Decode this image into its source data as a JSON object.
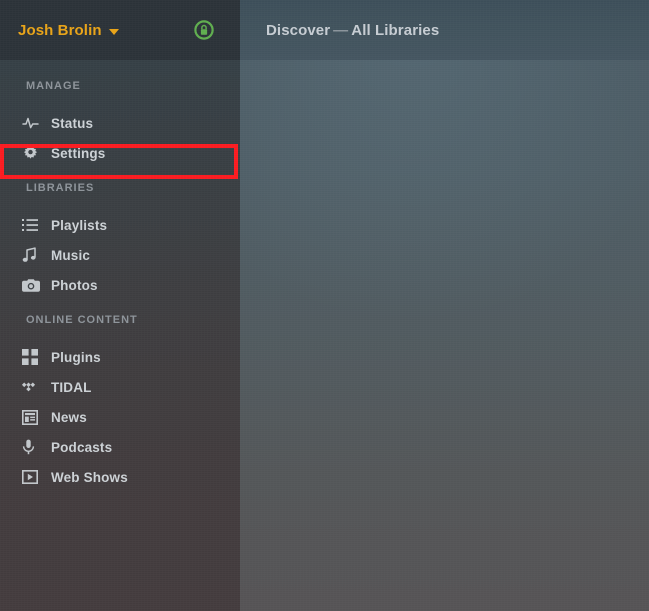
{
  "colors": {
    "accent_user": "#e8a317",
    "lock_green": "#5fad4e",
    "highlight_red": "#fb1b20",
    "sidebar_top": "#333f46",
    "sidebar_bottom": "#433b3d",
    "content_top": "#465761",
    "content_bottom": "#555355",
    "header_dark": "#2b3238",
    "label_gray": "#8d9399",
    "item_text": "#ccd1d5"
  },
  "sidebar": {
    "user": {
      "name": "Josh Brolin",
      "caret_icon": "chevron-down-icon"
    },
    "secure_badge": {
      "icon": "lock-circle-icon",
      "label": "Secure connection"
    },
    "groups": [
      {
        "label": "MANAGE",
        "items": [
          {
            "label": "Status",
            "icon": "activity-pulse-icon"
          },
          {
            "label": "Settings",
            "icon": "gear-icon",
            "highlighted": true
          }
        ]
      },
      {
        "label": "LIBRARIES",
        "items": [
          {
            "label": "Playlists",
            "icon": "list-icon"
          },
          {
            "label": "Music",
            "icon": "music-note-icon"
          },
          {
            "label": "Photos",
            "icon": "camera-icon"
          }
        ]
      },
      {
        "label": "ONLINE CONTENT",
        "items": [
          {
            "label": "Plugins",
            "icon": "grid-squares-icon"
          },
          {
            "label": "TIDAL",
            "icon": "tidal-logo-icon"
          },
          {
            "label": "News",
            "icon": "newspaper-icon"
          },
          {
            "label": "Podcasts",
            "icon": "microphone-icon"
          },
          {
            "label": "Web Shows",
            "icon": "play-box-icon"
          }
        ]
      }
    ]
  },
  "content": {
    "title_primary": "Discover",
    "title_separator": "—",
    "title_secondary": "All Libraries"
  }
}
